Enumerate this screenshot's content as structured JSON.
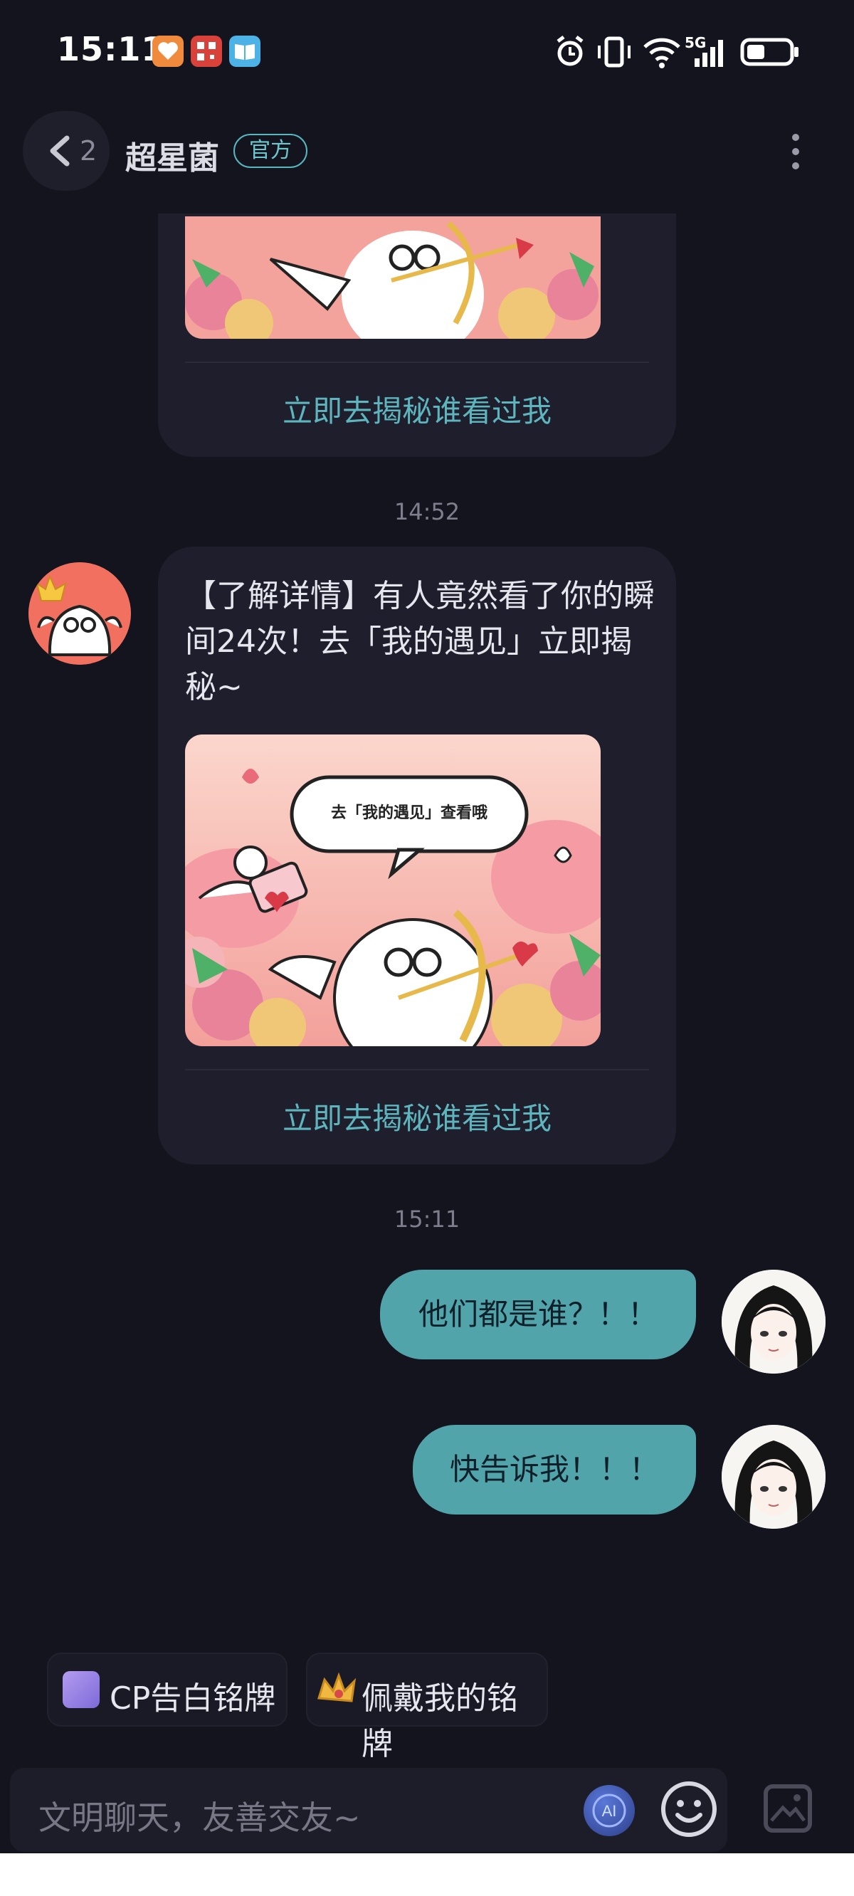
{
  "status_bar": {
    "time": "15:11",
    "icons": [
      "heart-app-icon",
      "qr-app-icon",
      "book-app-icon",
      "alarm-icon",
      "vibrate-icon",
      "wifi-icon",
      "5g-signal-icon",
      "battery-icon"
    ],
    "network_label": "5G"
  },
  "header": {
    "back_count": "2",
    "title": "超星菌",
    "badge": "官方"
  },
  "messages": {
    "top_card": {
      "link": "立即去揭秘谁看过我"
    },
    "time_1": "14:52",
    "card": {
      "text": "【了解详情】有人竟然看了你的瞬间24次！去「我的遇见」立即揭秘~",
      "image_caption": "去「我的遇见」查看哦",
      "link": "立即去揭秘谁看过我"
    },
    "time_2": "15:11",
    "out_1": "他们都是谁？！！",
    "out_2": "快告诉我！！！"
  },
  "quick_actions": {
    "chip_1": "CP告白铭牌",
    "chip_2": "佩戴我的铭牌"
  },
  "input": {
    "placeholder": "文明聊天，友善交友~"
  },
  "colors": {
    "background": "#14141f",
    "card": "#1e1e2c",
    "accent": "#5fb5be",
    "outgoing_bubble": "#52a4ab"
  }
}
